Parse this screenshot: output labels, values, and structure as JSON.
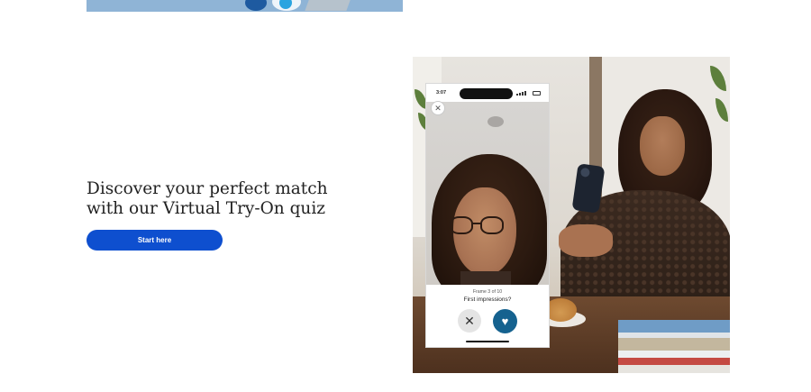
{
  "promo": {
    "headline_line1": "Discover your perfect match",
    "headline_line2": "with our Virtual Try-On quiz",
    "cta_label": "Start here"
  },
  "phone": {
    "status_time": "3:07",
    "frame_counter": "Frame 3 of 10",
    "prompt": "First impressions?",
    "close_symbol": "✕",
    "skip_symbol": "✕",
    "like_symbol": "♥"
  },
  "colors": {
    "cta_background": "#0e4fcf",
    "like_button": "#15628f",
    "skip_button": "#e4e4e4"
  },
  "icons": [
    "close-icon",
    "x-icon",
    "heart-icon"
  ]
}
